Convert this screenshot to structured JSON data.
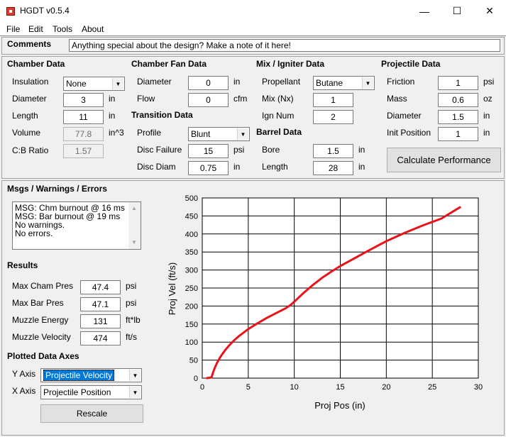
{
  "window": {
    "title": "HGDT v0.5.4",
    "minimize": "—",
    "maximize": "☐",
    "close": "✕"
  },
  "menu": [
    "File",
    "Edit",
    "Tools",
    "About"
  ],
  "comments": {
    "label": "Comments",
    "value": "Anything special about the design?  Make a note of it here!"
  },
  "chamber": {
    "title": "Chamber Data",
    "insulation": {
      "label": "Insulation",
      "value": "None"
    },
    "diameter": {
      "label": "Diameter",
      "value": "3",
      "unit": "in"
    },
    "length": {
      "label": "Length",
      "value": "11",
      "unit": "in"
    },
    "volume": {
      "label": "Volume",
      "value": "77.8",
      "unit": "in^3"
    },
    "cb_ratio": {
      "label": "C:B Ratio",
      "value": "1.57"
    }
  },
  "fan": {
    "title": "Chamber Fan Data",
    "diameter": {
      "label": "Diameter",
      "value": "0",
      "unit": "in"
    },
    "flow": {
      "label": "Flow",
      "value": "0",
      "unit": "cfm"
    }
  },
  "transition": {
    "title": "Transition Data",
    "profile": {
      "label": "Profile",
      "value": "Blunt"
    },
    "disc_failure": {
      "label": "Disc Failure",
      "value": "15",
      "unit": "psi"
    },
    "disc_diam": {
      "label": "Disc Diam",
      "value": "0.75",
      "unit": "in"
    }
  },
  "mix": {
    "title": "Mix / Igniter Data",
    "propellant": {
      "label": "Propellant",
      "value": "Butane"
    },
    "mix_nx": {
      "label": "Mix (Nx)",
      "value": "1"
    },
    "ign_num": {
      "label": "Ign Num",
      "value": "2"
    }
  },
  "barrel": {
    "title": "Barrel Data",
    "bore": {
      "label": "Bore",
      "value": "1.5",
      "unit": "in"
    },
    "length": {
      "label": "Length",
      "value": "28",
      "unit": "in"
    }
  },
  "projectile": {
    "title": "Projectile Data",
    "friction": {
      "label": "Friction",
      "value": "1",
      "unit": "psi"
    },
    "mass": {
      "label": "Mass",
      "value": "0.6",
      "unit": "oz"
    },
    "diameter": {
      "label": "Diameter",
      "value": "1.5",
      "unit": "in"
    },
    "init_position": {
      "label": "Init Position",
      "value": "1",
      "unit": "in"
    }
  },
  "calculate_button": "Calculate Performance",
  "messages": {
    "title": "Msgs / Warnings / Errors",
    "lines": [
      "MSG: Chm burnout @ 16 ms",
      "MSG: Bar burnout @ 19 ms",
      "No warnings.",
      "No errors."
    ]
  },
  "results": {
    "title": "Results",
    "max_cham_pres": {
      "label": "Max Cham Pres",
      "value": "47.4",
      "unit": "psi"
    },
    "max_bar_pres": {
      "label": "Max Bar Pres",
      "value": "47.1",
      "unit": "psi"
    },
    "muzzle_energy": {
      "label": "Muzzle Energy",
      "value": "131",
      "unit": "ft*lb"
    },
    "muzzle_velocity": {
      "label": "Muzzle Velocity",
      "value": "474",
      "unit": "ft/s"
    }
  },
  "axes": {
    "title": "Plotted Data Axes",
    "y_axis": {
      "label": "Y Axis",
      "value": "Projectile Velocity"
    },
    "x_axis": {
      "label": "X Axis",
      "value": "Projectile Position"
    }
  },
  "rescale_button": "Rescale",
  "colors": {
    "line": "#e8141c",
    "grid": "#000000"
  },
  "chart_data": {
    "type": "line",
    "xlabel": "Proj Pos (in)",
    "ylabel": "Proj Vel (ft/s)",
    "xlim": [
      0,
      30
    ],
    "ylim": [
      0,
      500
    ],
    "xticks": [
      0,
      5,
      10,
      15,
      20,
      25,
      30
    ],
    "yticks": [
      0,
      50,
      100,
      150,
      200,
      250,
      300,
      350,
      400,
      450,
      500
    ],
    "grid": true,
    "series": [
      {
        "x": [
          0.5,
          1.0,
          1.1,
          1.3,
          1.6,
          2.0,
          2.5,
          3.0,
          3.5,
          4.0,
          5.0,
          6.0,
          7.0,
          8.0,
          9.0,
          9.6,
          10.0,
          11.0,
          12.0,
          13.0,
          14.0,
          15.0,
          16.0,
          18.0,
          20.0,
          22.0,
          24.0,
          26.0,
          28.0
        ],
        "y": [
          0,
          2,
          10,
          25,
          42,
          60,
          78,
          93,
          106,
          117,
          136,
          152,
          167,
          180,
          193,
          203,
          212,
          236,
          258,
          278,
          295,
          311,
          325,
          353,
          380,
          403,
          424,
          443,
          474
        ]
      }
    ]
  }
}
